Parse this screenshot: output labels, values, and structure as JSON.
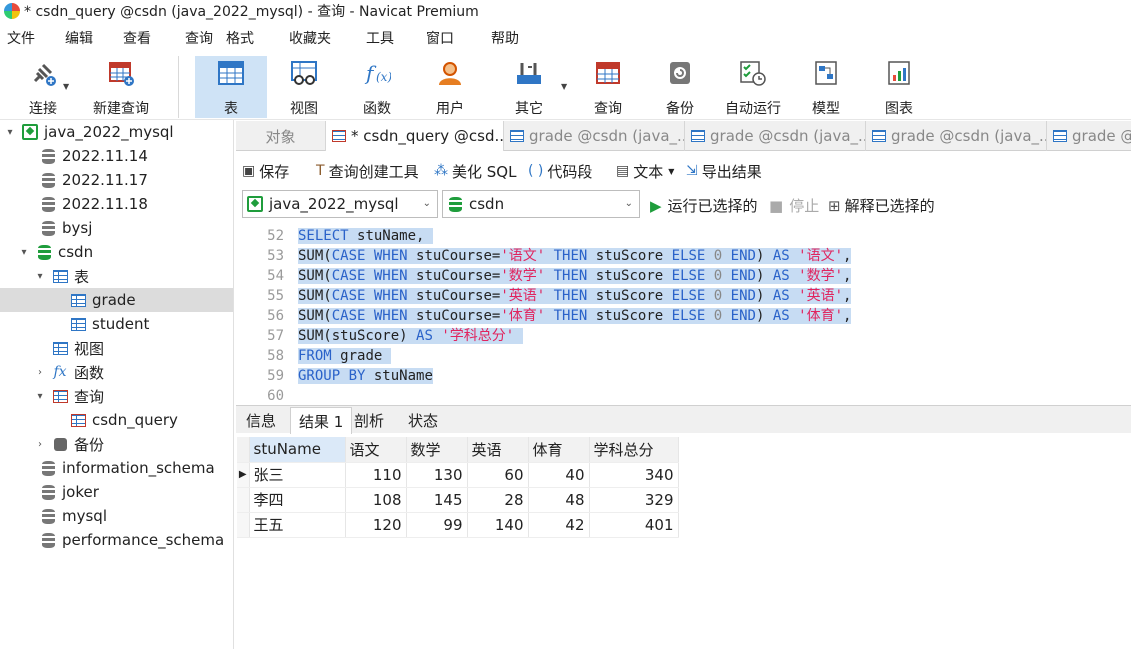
{
  "window": {
    "title": "* csdn_query @csdn (java_2022_mysql) - 查询 - Navicat Premium"
  },
  "menu": [
    "文件",
    "编辑",
    "查看",
    "查询",
    "格式",
    "收藏夹",
    "工具",
    "窗口",
    "帮助"
  ],
  "toolbar": {
    "connect": "连接",
    "new_query": "新建查询",
    "table": "表",
    "view": "视图",
    "function": "函数",
    "user": "用户",
    "other": "其它",
    "query": "查询",
    "backup": "备份",
    "auto_run": "自动运行",
    "model": "模型",
    "chart": "图表"
  },
  "tree": {
    "connection": "java_2022_mysql",
    "dbs": [
      "2022.11.14",
      "2022.11.17",
      "2022.11.18",
      "bysj"
    ],
    "csdn": "csdn",
    "tables_folder": "表",
    "table_grade": "grade",
    "table_student": "student",
    "views_folder": "视图",
    "funcs_folder": "函数",
    "queries_folder": "查询",
    "query_item": "csdn_query",
    "backup_folder": "备份",
    "other_dbs": [
      "information_schema",
      "joker",
      "mysql",
      "performance_schema"
    ]
  },
  "tabs": {
    "objects": "对象",
    "active": "* csdn_query @csd...",
    "t2": "grade @csdn (java_...",
    "t3": "grade @csdn (java_...",
    "t4": "grade @csdn (java_...",
    "t5": "grade @"
  },
  "query_toolbar": {
    "save": "保存",
    "builder": "查询创建工具",
    "beautify": "美化 SQL",
    "snippet": "代码段",
    "text": "文本",
    "export": "导出结果"
  },
  "selectors": {
    "connection": "java_2022_mysql",
    "database": "csdn",
    "run_selected": "运行已选择的",
    "stop": "停止",
    "explain": "解释已选择的"
  },
  "editor": {
    "line_numbers": [
      "52",
      "53",
      "54",
      "55",
      "56",
      "57",
      "58",
      "59",
      "60"
    ]
  },
  "result_tabs": [
    "信息",
    "结果 1",
    "剖析",
    "状态"
  ],
  "results": {
    "columns": [
      "stuName",
      "语文",
      "数学",
      "英语",
      "体育",
      "学科总分"
    ],
    "rows": [
      [
        "张三",
        "110",
        "130",
        "60",
        "40",
        "340"
      ],
      [
        "李四",
        "108",
        "145",
        "28",
        "48",
        "329"
      ],
      [
        "王五",
        "120",
        "99",
        "140",
        "42",
        "401"
      ]
    ]
  },
  "colors": {
    "selection": "#c7dcf3",
    "keyword": "#2a62c9",
    "string": "#e0245e",
    "active_tool": "#cfe3f6"
  }
}
